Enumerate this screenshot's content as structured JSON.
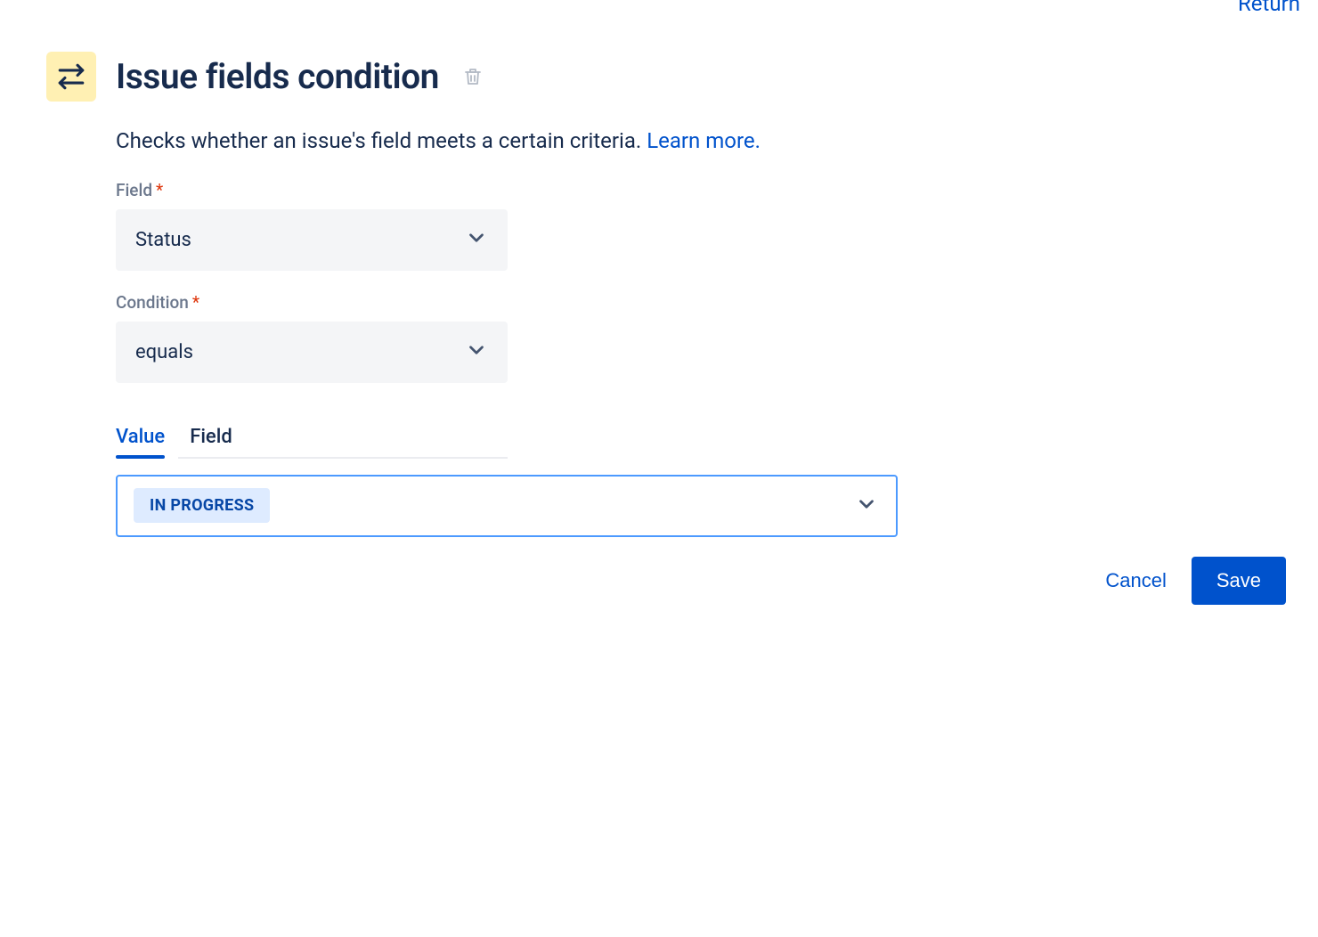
{
  "topLink": "Return",
  "header": {
    "title": "Issue fields condition"
  },
  "description": {
    "text": "Checks whether an issue's field meets a certain criteria. ",
    "link": "Learn more."
  },
  "form": {
    "fieldLabel": "Field",
    "fieldValue": "Status",
    "conditionLabel": "Condition",
    "conditionValue": "equals"
  },
  "tabs": {
    "valueLabel": "Value",
    "fieldLabel": "Field"
  },
  "valueSelect": {
    "selected": "IN PROGRESS"
  },
  "footer": {
    "cancel": "Cancel",
    "save": "Save"
  }
}
